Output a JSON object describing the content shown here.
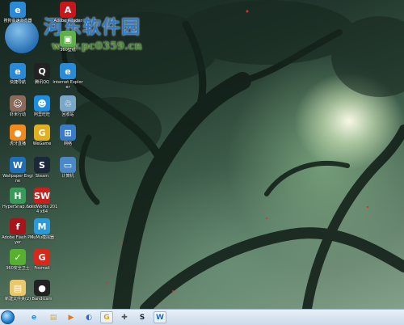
{
  "watermark": {
    "title": "河东软件园",
    "url": "www.pc0359.cn"
  },
  "desktop_icons": [
    {
      "label": "搜狗高速浏览器",
      "icon": "sogou-browser-icon",
      "color": "#2a8ad8",
      "glyph": "e"
    },
    {
      "label": "Adobe Reader",
      "icon": "adobe-reader-icon",
      "color": "#c8161d",
      "glyph": "A"
    },
    {
      "label": "360壁纸",
      "icon": "360-wallpaper-icon",
      "color": "#5fb04a",
      "glyph": "▣"
    },
    {
      "label": "快捷导航",
      "icon": "quick-nav-ie-icon",
      "color": "#2a8ad8",
      "glyph": "e"
    },
    {
      "label": "腾讯QQ",
      "icon": "qq-penguin-icon",
      "color": "#222222",
      "glyph": "Q"
    },
    {
      "label": "Internet Explorer",
      "icon": "internet-explorer-icon",
      "color": "#2a8ad8",
      "glyph": "e"
    },
    {
      "label": "虾米行动",
      "icon": "game-character-icon",
      "color": "#8a6a5a",
      "glyph": "☺"
    },
    {
      "label": "阿里旺旺",
      "icon": "aliwangwang-icon",
      "color": "#1f8ee0",
      "glyph": "☻"
    },
    {
      "label": "回收站",
      "icon": "recycle-bin-icon",
      "color": "#7aa6c8",
      "glyph": "♲"
    },
    {
      "label": "虎牙直播",
      "icon": "huya-live-icon",
      "color": "#f08a1c",
      "glyph": "●"
    },
    {
      "label": "WeGame",
      "icon": "wegame-icon",
      "color": "#e0b020",
      "glyph": "G"
    },
    {
      "label": "网络",
      "icon": "network-icon",
      "color": "#3a7bc8",
      "glyph": "⊞"
    },
    {
      "label": "Wallpaper Engine",
      "icon": "wallpaper-engine-icon",
      "color": "#1f6fb8",
      "glyph": "W"
    },
    {
      "label": "Steam",
      "icon": "steam-icon",
      "color": "#1b2838",
      "glyph": "S"
    },
    {
      "label": "计算机",
      "icon": "computer-icon",
      "color": "#4a88c8",
      "glyph": "▭"
    },
    {
      "label": "HyperSnap.exe",
      "icon": "hypersnap-icon",
      "color": "#3a9a5a",
      "glyph": "H"
    },
    {
      "label": "SolidWorks 2014 x64",
      "icon": "solidworks-icon",
      "color": "#c8201c",
      "glyph": "SW"
    },
    {
      "label": "Adobe Flash Player",
      "icon": "adobe-flash-icon",
      "color": "#a8141c",
      "glyph": "f"
    },
    {
      "label": "MuMu模拟器",
      "icon": "mumu-emulator-icon",
      "color": "#2a9ad8",
      "glyph": "M"
    },
    {
      "label": "360安全卫士",
      "icon": "360-safeguard-icon",
      "color": "#58b030",
      "glyph": "✓"
    },
    {
      "label": "Foxmail",
      "icon": "foxmail-icon",
      "color": "#d8281c",
      "glyph": "G"
    },
    {
      "label": "新建文件夹(2)",
      "icon": "folder-icon",
      "color": "#e8c868",
      "glyph": "▤"
    },
    {
      "label": "Bandicam",
      "icon": "bandicam-icon",
      "color": "#222222",
      "glyph": "●"
    }
  ],
  "taskbar_items": [
    {
      "icon": "ie-taskbar-icon",
      "glyph": "e",
      "color": "#2a8ad8"
    },
    {
      "icon": "explorer-folder-taskbar-icon",
      "glyph": "▤",
      "color": "#d8a838"
    },
    {
      "icon": "media-player-taskbar-icon",
      "glyph": "▶",
      "color": "#e07820"
    },
    {
      "icon": "browser-taskbar-icon",
      "glyph": "◐",
      "color": "#2a6ad8"
    },
    {
      "icon": "wegame-taskbar-icon",
      "glyph": "G",
      "color": "#d8a820"
    },
    {
      "icon": "gamepad-taskbar-icon",
      "glyph": "✚",
      "color": "#555555"
    },
    {
      "icon": "steam-taskbar-icon",
      "glyph": "S",
      "color": "#1b2838"
    },
    {
      "icon": "wallpaper-engine-taskbar-icon",
      "glyph": "W",
      "color": "#1f6fb8"
    }
  ]
}
